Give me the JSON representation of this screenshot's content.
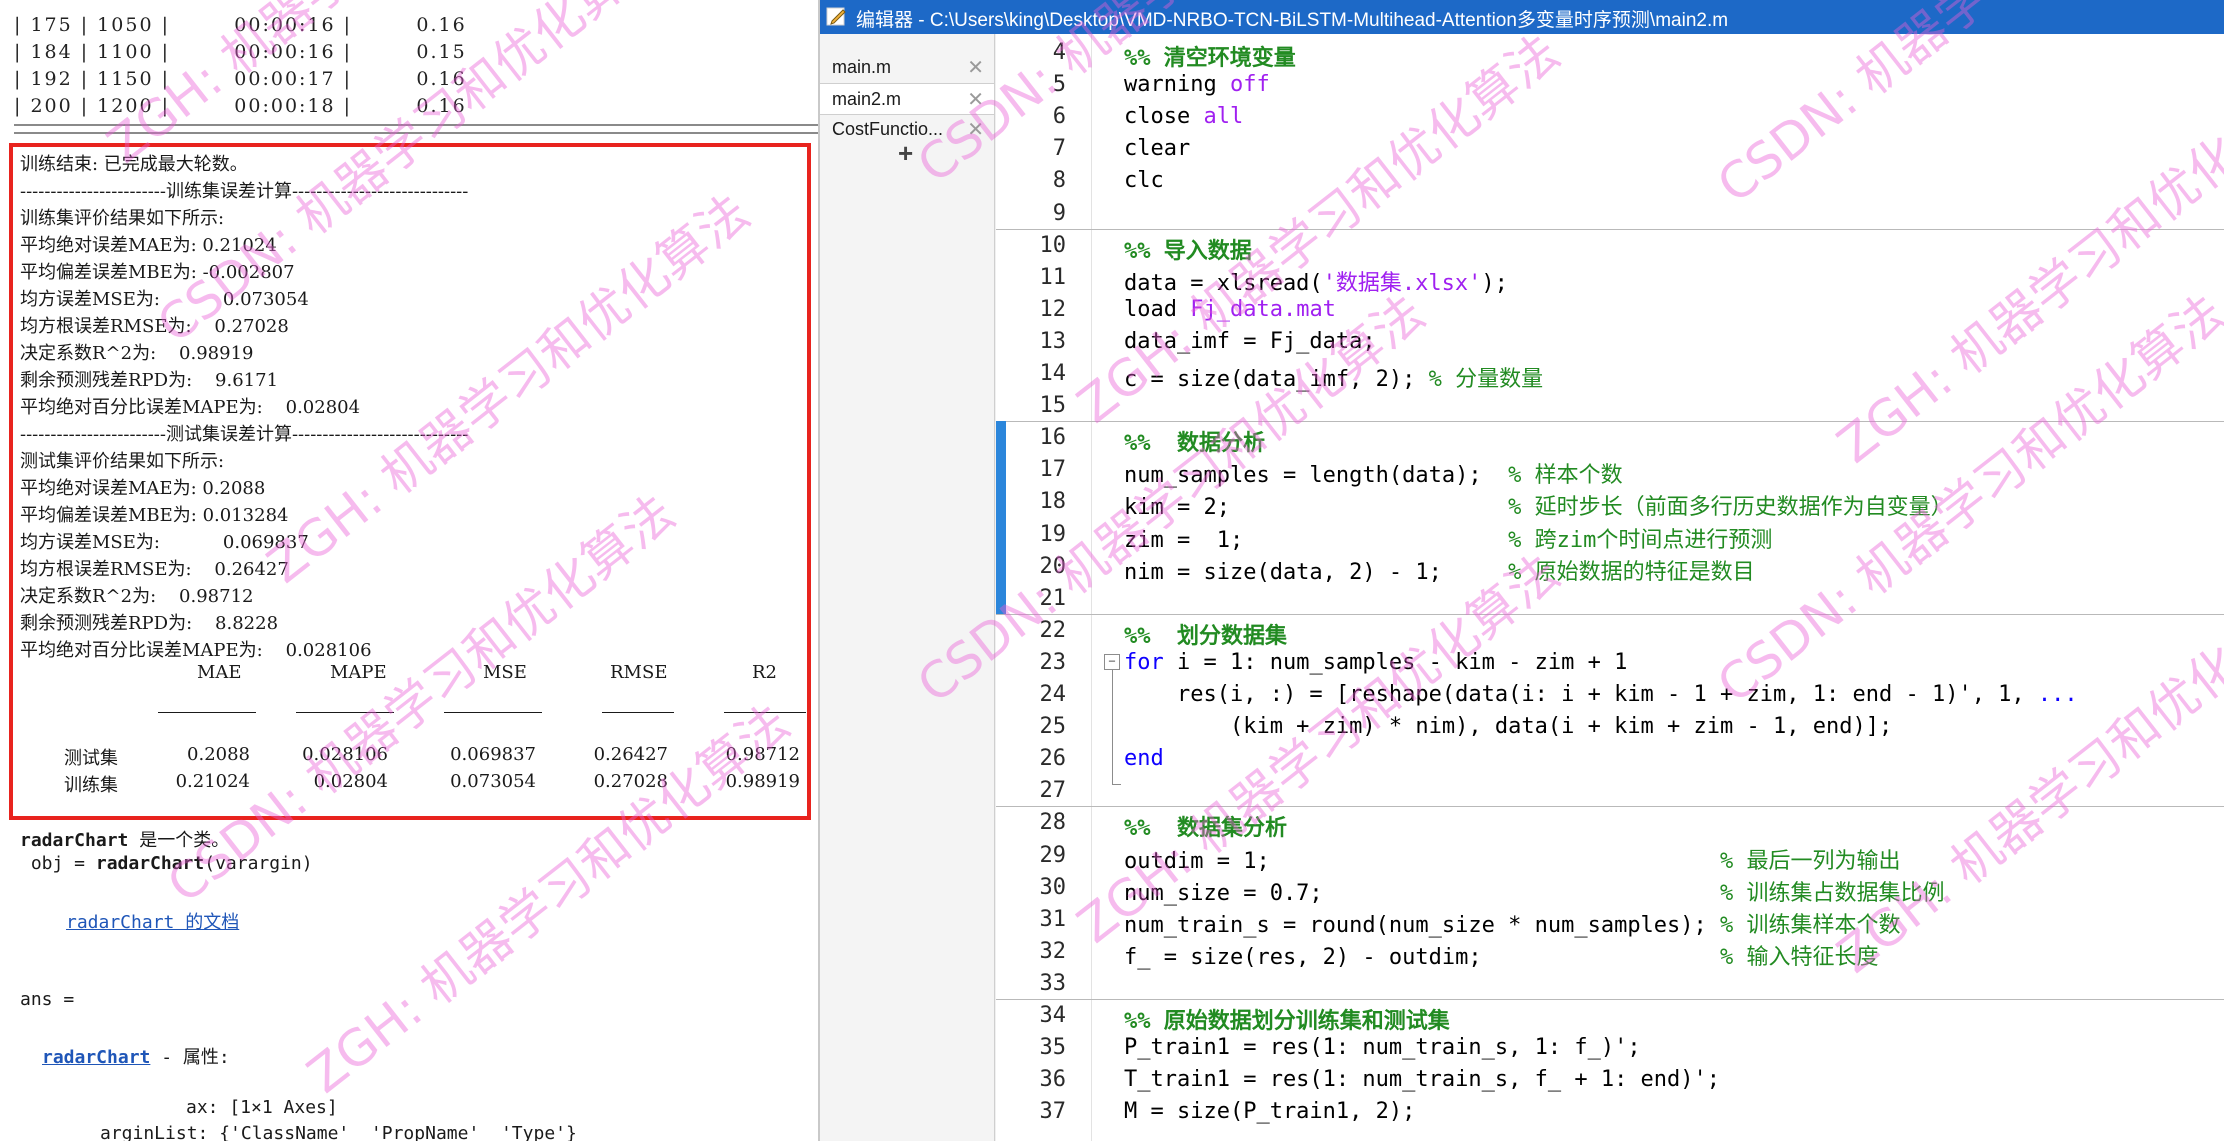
{
  "command_window": {
    "iter_rows": [
      "| 175 | 1050 |        00:00:16 |        0.16",
      "| 184 | 1100 |        00:00:16 |        0.15",
      "| 192 | 1150 |        00:00:17 |        0.16",
      "| 200 | 1200 |        00:00:18 |        0.16"
    ],
    "train_done": "训练结束: 已完成最大轮数。",
    "train_header": "------------------------训练集误差计算-----------------------------",
    "train_eval": "训练集评价结果如下所示:",
    "train_metrics": [
      "平均绝对误差MAE为: 0.21024",
      "平均偏差误差MBE为: -0.002807",
      "均方误差MSE为:           0.073054",
      "均方根误差RMSE为:    0.27028",
      "决定系数R^2为:    0.98919",
      "剩余预测残差RPD为:    9.6171",
      "平均绝对百分比误差MAPE为:    0.02804"
    ],
    "test_header": "------------------------测试集误差计算-----------------------------",
    "test_eval": "测试集评价结果如下所示:",
    "test_metrics": [
      "平均绝对误差MAE为: 0.2088",
      "平均偏差误差MBE为: 0.013284",
      "均方误差MSE为:           0.069837",
      "均方根误差RMSE为:    0.26427",
      "决定系数R^2为:    0.98712",
      "剩余预测残差RPD为:    8.8228",
      "平均绝对百分比误差MAPE为:    0.028106"
    ],
    "metrics_table": {
      "columns": [
        "MAE",
        "MAPE",
        "MSE",
        "RMSE",
        "R2"
      ],
      "rows": [
        {
          "name": "测试集",
          "values": [
            "0.2088",
            "0.028106",
            "0.069837",
            "0.26427",
            "0.98712"
          ]
        },
        {
          "name": "训练集",
          "values": [
            "0.21024",
            "0.02804",
            "0.073054",
            "0.27028",
            "0.98919"
          ]
        }
      ]
    },
    "radar_intro_name": "radarChart",
    "radar_intro_rest": " 是一个类。",
    "radar_sig_pre": " obj = ",
    "radar_sig_name": "radarChart",
    "radar_sig_post": "(varargin)",
    "radar_doc_link": "radarChart 的文档",
    "ans_line": "ans =",
    "radar_prop_name": "radarChart",
    "radar_prop_rest": " - 属性:",
    "prop_ax": "ax: [1×1 Axes]",
    "prop_arglist": "arginList: {'ClassName'  'PropName'  'Type'}"
  },
  "editor": {
    "title": "编辑器 - C:\\Users\\king\\Desktop\\VMD-NRBO-TCN-BiLSTM-Multihead-Attention多变量时序预测\\main2.m",
    "tabs": [
      {
        "label": "main.m",
        "active": false
      },
      {
        "label": "main2.m",
        "active": true
      },
      {
        "label": "CostFunctio...",
        "active": false
      }
    ],
    "add_tab": "+",
    "lines": [
      {
        "n": "4",
        "parts": [
          {
            "t": "%% 清空环境变量",
            "c": "cmh"
          }
        ]
      },
      {
        "n": "5",
        "parts": [
          {
            "t": "warning ",
            "c": ""
          },
          {
            "t": "off",
            "c": "str"
          }
        ]
      },
      {
        "n": "6",
        "parts": [
          {
            "t": "close ",
            "c": ""
          },
          {
            "t": "all",
            "c": "str"
          }
        ]
      },
      {
        "n": "7",
        "parts": [
          {
            "t": "clear",
            "c": ""
          }
        ]
      },
      {
        "n": "8",
        "parts": [
          {
            "t": "clc",
            "c": ""
          }
        ]
      },
      {
        "n": "9",
        "parts": []
      },
      {
        "n": "10",
        "parts": [
          {
            "t": "%% 导入数据",
            "c": "cmh"
          }
        ]
      },
      {
        "n": "11",
        "parts": [
          {
            "t": "data = xlsread(",
            "c": ""
          },
          {
            "t": "'数据集.xlsx'",
            "c": "str"
          },
          {
            "t": ");",
            "c": ""
          }
        ]
      },
      {
        "n": "12",
        "parts": [
          {
            "t": "load ",
            "c": ""
          },
          {
            "t": "Fj_data.mat",
            "c": "str"
          }
        ]
      },
      {
        "n": "13",
        "parts": [
          {
            "t": "data_imf = Fj_data;",
            "c": ""
          }
        ]
      },
      {
        "n": "14",
        "parts": [
          {
            "t": "c = size(data_imf, 2); ",
            "c": ""
          },
          {
            "t": "% 分量数量",
            "c": "cm"
          }
        ]
      },
      {
        "n": "15",
        "parts": []
      },
      {
        "n": "16",
        "parts": [
          {
            "t": "%%  数据分析",
            "c": "cmh"
          }
        ]
      },
      {
        "n": "17",
        "parts": [
          {
            "t": "num_samples = length(data);  ",
            "c": ""
          },
          {
            "t": "% 样本个数",
            "c": "cm"
          }
        ]
      },
      {
        "n": "18",
        "parts": [
          {
            "t": "kim = 2;                     ",
            "c": ""
          },
          {
            "t": "% 延时步长（前面多行历史数据作为自变量）",
            "c": "cm"
          }
        ]
      },
      {
        "n": "19",
        "parts": [
          {
            "t": "zim =  1;                    ",
            "c": ""
          },
          {
            "t": "% 跨zim个时间点进行预测",
            "c": "cm"
          }
        ]
      },
      {
        "n": "20",
        "parts": [
          {
            "t": "nim = size(data, 2) - 1;     ",
            "c": ""
          },
          {
            "t": "% 原始数据的特征是数目",
            "c": "cm"
          }
        ]
      },
      {
        "n": "21",
        "parts": []
      },
      {
        "n": "22",
        "parts": [
          {
            "t": "%%  划分数据集",
            "c": "cmh"
          }
        ]
      },
      {
        "n": "23",
        "parts": [
          {
            "t": "for",
            "c": "kw"
          },
          {
            "t": " i = 1: num_samples - kim - zim + 1",
            "c": ""
          }
        ]
      },
      {
        "n": "24",
        "parts": [
          {
            "t": "    res(i, :) = [reshape(data(i: i + kim - 1 + zim, 1: end - 1)', 1, ",
            "c": ""
          },
          {
            "t": "...",
            "c": "kw"
          }
        ]
      },
      {
        "n": "25",
        "parts": [
          {
            "t": "        (kim + zim) * nim), data(i + kim + zim - 1, end)];",
            "c": ""
          }
        ]
      },
      {
        "n": "26",
        "parts": [
          {
            "t": "end",
            "c": "kw"
          }
        ]
      },
      {
        "n": "27",
        "parts": []
      },
      {
        "n": "28",
        "parts": [
          {
            "t": "%%  数据集分析",
            "c": "cmh"
          }
        ]
      },
      {
        "n": "29",
        "parts": [
          {
            "t": "outdim = 1;                                  ",
            "c": ""
          },
          {
            "t": "% 最后一列为输出",
            "c": "cm"
          }
        ]
      },
      {
        "n": "30",
        "parts": [
          {
            "t": "num_size = 0.7;                              ",
            "c": ""
          },
          {
            "t": "% 训练集占数据集比例",
            "c": "cm"
          }
        ]
      },
      {
        "n": "31",
        "parts": [
          {
            "t": "num_train_s = round(num_size * num_samples); ",
            "c": ""
          },
          {
            "t": "% 训练集样本个数",
            "c": "cm"
          }
        ]
      },
      {
        "n": "32",
        "parts": [
          {
            "t": "f_ = size(res, 2) - outdim;                  ",
            "c": ""
          },
          {
            "t": "% 输入特征长度",
            "c": "cm"
          }
        ]
      },
      {
        "n": "33",
        "parts": []
      },
      {
        "n": "34",
        "parts": [
          {
            "t": "%% 原始数据划分训练集和测试集",
            "c": "cmh"
          }
        ]
      },
      {
        "n": "35",
        "parts": [
          {
            "t": "P_train1 = res(1: num_train_s, 1: f_)';",
            "c": ""
          }
        ]
      },
      {
        "n": "36",
        "parts": [
          {
            "t": "T_train1 = res(1: num_train_s, f_ + 1: end)';",
            "c": ""
          }
        ]
      },
      {
        "n": "37",
        "parts": [
          {
            "t": "M = size(P_train1, 2);",
            "c": ""
          }
        ]
      }
    ]
  },
  "watermark": "ZGH: 机器学习和优化算法",
  "watermark_alt": "CSDN: 机器学习和优化算法",
  "colors": {
    "title_bar": "#1d69c7",
    "highlight_box": "#e8231e",
    "cell_bar": "#2b86db",
    "keyword": "#0e00ff",
    "comment": "#228b22",
    "string": "#a020f0"
  }
}
